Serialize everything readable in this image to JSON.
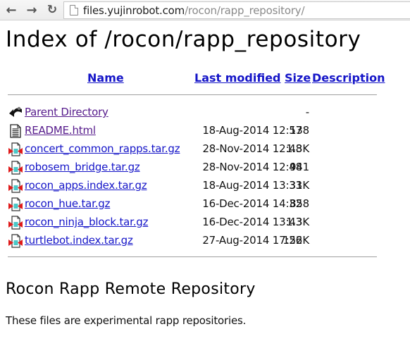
{
  "browser": {
    "back_icon": "arrow-left",
    "forward_icon": "arrow-right",
    "reload_icon": "reload",
    "page_icon": "document",
    "url_host": "files.yujinrobot.com",
    "url_path": "/rocon/rapp_repository/"
  },
  "page": {
    "title": "Index of /rocon/rapp_repository",
    "columns": {
      "name": "Name",
      "last_modified": "Last modified",
      "size": "Size",
      "description": "Description"
    },
    "entries": [
      {
        "icon": "back-folder",
        "name": "Parent Directory",
        "last_modified": "",
        "size": "-",
        "visited": true
      },
      {
        "icon": "text-file",
        "name": "README.html",
        "last_modified": "18-Aug-2014 12:57",
        "size": "138",
        "visited": true
      },
      {
        "icon": "compressed-file",
        "name": "concert_common_rapps.tar.gz",
        "last_modified": "28-Nov-2014 12:48",
        "size": "1.3K",
        "visited": false
      },
      {
        "icon": "compressed-file",
        "name": "robosem_bridge.tar.gz",
        "last_modified": "28-Nov-2014 12:48",
        "size": "941",
        "visited": false
      },
      {
        "icon": "compressed-file",
        "name": "rocon_apps.index.tar.gz",
        "last_modified": "18-Aug-2014 13:33",
        "size": "31K",
        "visited": false
      },
      {
        "icon": "compressed-file",
        "name": "rocon_hue.tar.gz",
        "last_modified": "16-Dec-2014 14:32",
        "size": "858",
        "visited": false
      },
      {
        "icon": "compressed-file",
        "name": "rocon_ninja_block.tar.gz",
        "last_modified": "16-Dec-2014 13:43",
        "size": "1.3K",
        "visited": false
      },
      {
        "icon": "compressed-file",
        "name": "turtlebot.index.tar.gz",
        "last_modified": "27-Aug-2014 17:26",
        "size": "152K",
        "visited": false
      }
    ],
    "footer_heading": "Rocon Rapp Remote Repository",
    "footer_text": "These files are experimental rapp repositories."
  },
  "colors": {
    "link": "#1515c8",
    "visited": "#551a8b"
  }
}
